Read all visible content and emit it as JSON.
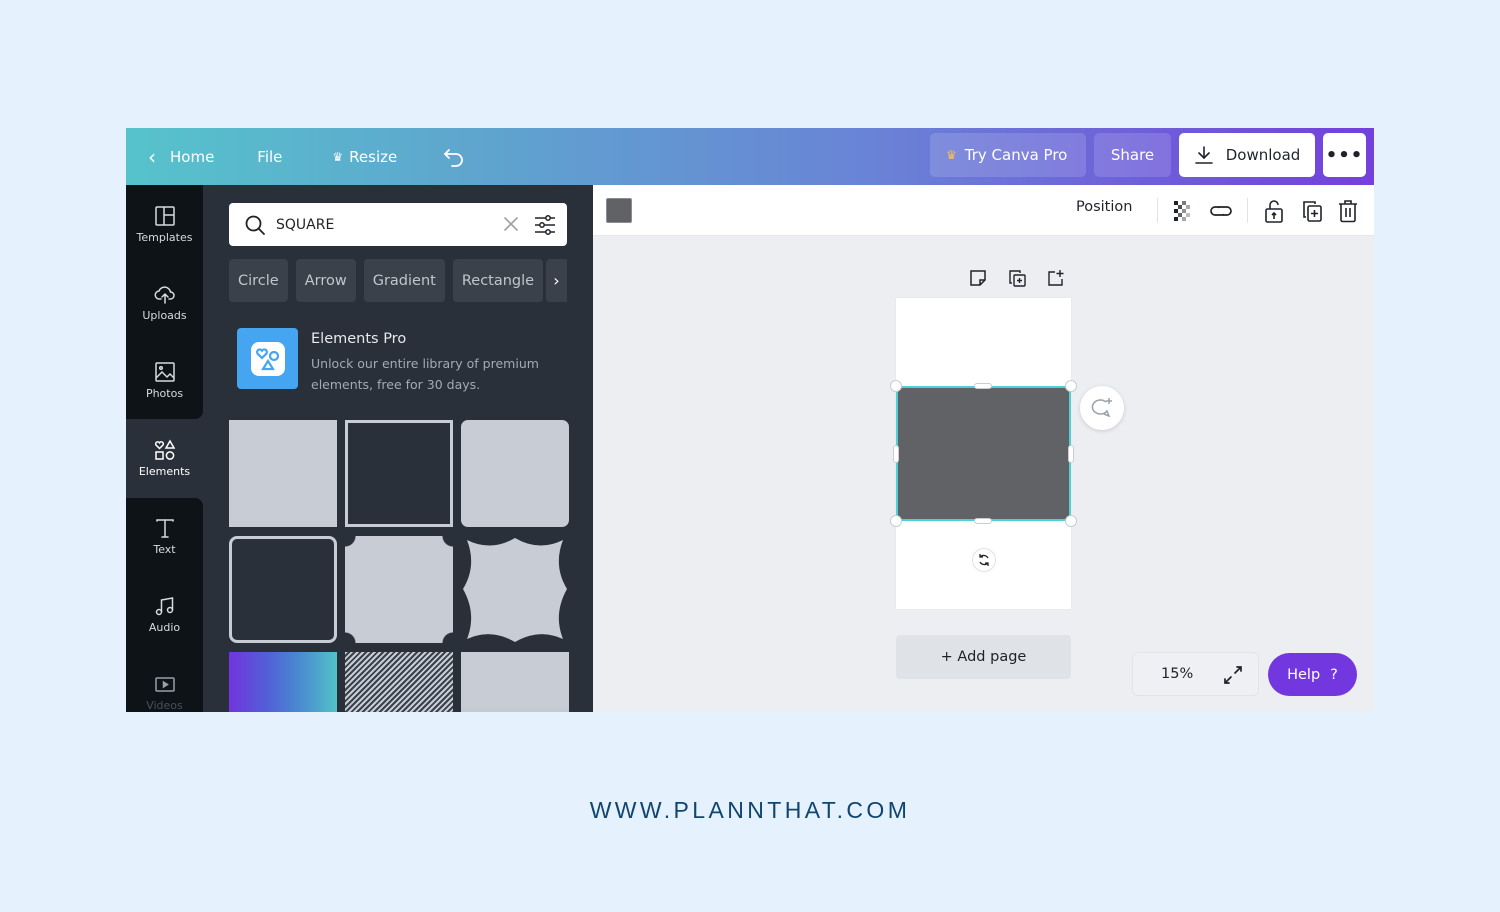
{
  "topbar": {
    "home_label": "Home",
    "file_label": "File",
    "resize_label": "Resize",
    "try_pro_label": "Try Canva Pro",
    "share_label": "Share",
    "download_label": "Download",
    "more_label": "•••",
    "gradient_start": "#56c3cb",
    "gradient_end": "#7340dc"
  },
  "sidebar": {
    "items": [
      {
        "label": "Templates",
        "icon": "templates-icon"
      },
      {
        "label": "Uploads",
        "icon": "cloud-upload-icon"
      },
      {
        "label": "Photos",
        "icon": "image-icon"
      },
      {
        "label": "Elements",
        "icon": "shapes-icon",
        "active": true
      },
      {
        "label": "Text",
        "icon": "text-icon"
      },
      {
        "label": "Audio",
        "icon": "music-note-icon"
      },
      {
        "label": "Videos",
        "icon": "video-icon"
      }
    ]
  },
  "panel": {
    "search_value": "SQUARE",
    "chips": [
      "Circle",
      "Arrow",
      "Gradient",
      "Rectangle"
    ],
    "promo": {
      "title": "Elements Pro",
      "description": "Unlock our entire library of premium elements, free for 30 days."
    },
    "results": [
      "filled-square",
      "outlined-square",
      "rounded-square",
      "rounded-outlined-square",
      "notched-square",
      "wavy-square",
      "gradient-square",
      "striped-square",
      "gray-gradient-square"
    ]
  },
  "toolbar": {
    "color_swatch": "#616265",
    "position_label": "Position"
  },
  "canvas": {
    "selection_color": "#4fd0d7",
    "shape_color": "#616265",
    "add_page_label": "+ Add page",
    "zoom_level": "15%",
    "help_label": "Help",
    "help_icon": "?"
  },
  "footer": {
    "website": "WWW.PLANNTHAT.COM"
  }
}
